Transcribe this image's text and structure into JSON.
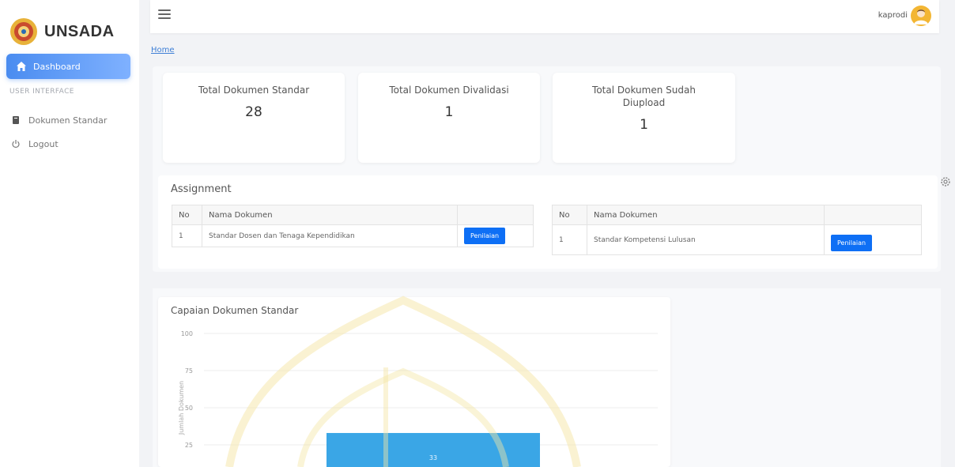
{
  "sidebar": {
    "brand": "UNSADA",
    "active_item": "Dashboard",
    "section_label": "USER INTERFACE",
    "items": [
      {
        "label": "Dokumen Standar",
        "icon": "book-icon"
      },
      {
        "label": "Logout",
        "icon": "power-icon"
      }
    ]
  },
  "topbar": {
    "user_name": "kaprodi"
  },
  "breadcrumb": "Home",
  "stats": [
    {
      "title": "Total Dokumen Standar",
      "value": "28"
    },
    {
      "title": "Total Dokumen Divalidasi",
      "value": "1"
    },
    {
      "title": "Total Dokumen Sudah Diupload",
      "value": "1"
    }
  ],
  "assignment": {
    "title": "Assignment",
    "headers": [
      "No",
      "Nama Dokumen"
    ],
    "left": [
      {
        "no": "1",
        "name": "Standar Dosen dan Tenaga Kependidikan",
        "button": "Penilaian"
      }
    ],
    "right": [
      {
        "no": "1",
        "name": "Standar Kompetensi Lulusan",
        "button": "Penilaian"
      }
    ]
  },
  "chart_data": {
    "type": "bar",
    "title": "Capaian Dokumen Standar",
    "ylabel": "Jumlah Dokumen",
    "ylim": [
      0,
      100
    ],
    "yticks": [
      "100",
      "75",
      "50",
      "25"
    ],
    "values": [
      33
    ],
    "bar_label": "33",
    "bar_color": "#3aa6e6",
    "grid": true
  },
  "colors": {
    "accent": "#4a8cf0",
    "button": "#0e6ff5",
    "link": "#3e7fd6"
  }
}
